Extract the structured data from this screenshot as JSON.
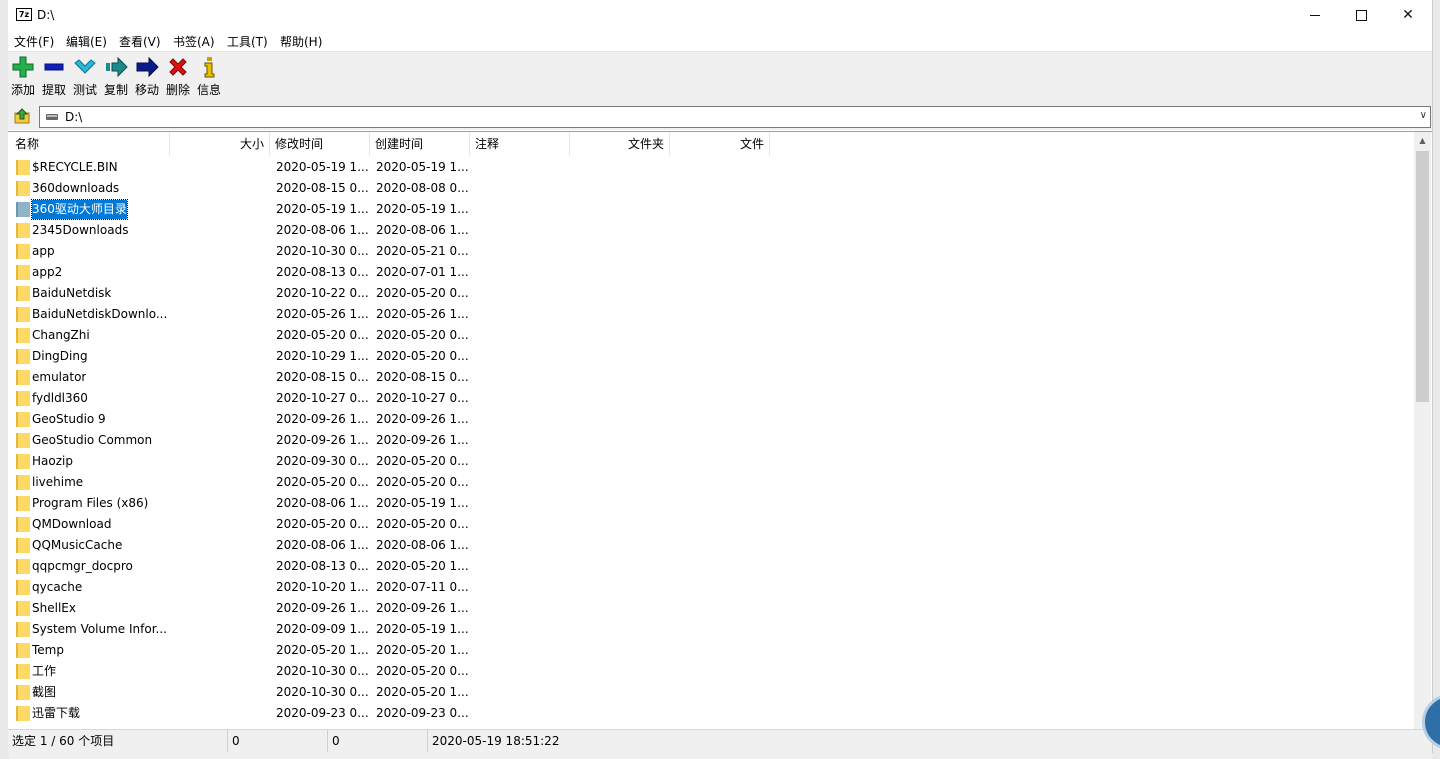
{
  "window": {
    "title": "D:\\",
    "icon": "7z-app-icon",
    "controls": [
      "minimize-icon",
      "maximize-icon",
      "close-icon"
    ]
  },
  "menu": [
    {
      "label": "文件(F)"
    },
    {
      "label": "编辑(E)"
    },
    {
      "label": "查看(V)"
    },
    {
      "label": "书签(A)"
    },
    {
      "label": "工具(T)"
    },
    {
      "label": "帮助(H)"
    }
  ],
  "toolbar": [
    {
      "label": "添加",
      "icon": "add-plus-icon",
      "color": "#22b14c"
    },
    {
      "label": "提取",
      "icon": "extract-minus-icon",
      "color": "#1020c0"
    },
    {
      "label": "测试",
      "icon": "test-check-icon",
      "color": "#2bb5d6"
    },
    {
      "label": "复制",
      "icon": "copy-arrow-icon",
      "color": "#1a8a8a"
    },
    {
      "label": "移动",
      "icon": "move-arrow-icon",
      "color": "#0a1a8a"
    },
    {
      "label": "删除",
      "icon": "delete-x-icon",
      "color": "#e01010"
    },
    {
      "label": "信息",
      "icon": "info-icon",
      "color": "#c8a000"
    }
  ],
  "address": {
    "value": "D:\\",
    "drive_icon": "drive-icon"
  },
  "columns": [
    "名称",
    "大小",
    "修改时间",
    "创建时间",
    "注释",
    "文件夹",
    "文件"
  ],
  "rows": [
    {
      "name": "$RECYCLE.BIN",
      "modified": "2020-05-19 1...",
      "created": "2020-05-19 1..."
    },
    {
      "name": "360downloads",
      "modified": "2020-08-15 0...",
      "created": "2020-08-08 0..."
    },
    {
      "name": "360驱动大师目录",
      "modified": "2020-05-19 1...",
      "created": "2020-05-19 1...",
      "selected": true
    },
    {
      "name": "2345Downloads",
      "modified": "2020-08-06 1...",
      "created": "2020-08-06 1..."
    },
    {
      "name": "app",
      "modified": "2020-10-30 0...",
      "created": "2020-05-21 0..."
    },
    {
      "name": "app2",
      "modified": "2020-08-13 0...",
      "created": "2020-07-01 1..."
    },
    {
      "name": "BaiduNetdisk",
      "modified": "2020-10-22 0...",
      "created": "2020-05-20 0..."
    },
    {
      "name": "BaiduNetdiskDownlo...",
      "modified": "2020-05-26 1...",
      "created": "2020-05-26 1..."
    },
    {
      "name": "ChangZhi",
      "modified": "2020-05-20 0...",
      "created": "2020-05-20 0..."
    },
    {
      "name": "DingDing",
      "modified": "2020-10-29 1...",
      "created": "2020-05-20 0..."
    },
    {
      "name": "emulator",
      "modified": "2020-08-15 0...",
      "created": "2020-08-15 0..."
    },
    {
      "name": "fydldl360",
      "modified": "2020-10-27 0...",
      "created": "2020-10-27 0..."
    },
    {
      "name": "GeoStudio 9",
      "modified": "2020-09-26 1...",
      "created": "2020-09-26 1..."
    },
    {
      "name": "GeoStudio Common",
      "modified": "2020-09-26 1...",
      "created": "2020-09-26 1..."
    },
    {
      "name": "Haozip",
      "modified": "2020-09-30 0...",
      "created": "2020-05-20 0..."
    },
    {
      "name": "livehime",
      "modified": "2020-05-20 0...",
      "created": "2020-05-20 0..."
    },
    {
      "name": "Program Files (x86)",
      "modified": "2020-08-06 1...",
      "created": "2020-05-19 1..."
    },
    {
      "name": "QMDownload",
      "modified": "2020-05-20 0...",
      "created": "2020-05-20 0..."
    },
    {
      "name": "QQMusicCache",
      "modified": "2020-08-06 1...",
      "created": "2020-08-06 1..."
    },
    {
      "name": "qqpcmgr_docpro",
      "modified": "2020-08-13 0...",
      "created": "2020-05-20 1..."
    },
    {
      "name": "qycache",
      "modified": "2020-10-20 1...",
      "created": "2020-07-11 0..."
    },
    {
      "name": "ShellEx",
      "modified": "2020-09-26 1...",
      "created": "2020-09-26 1..."
    },
    {
      "name": "System Volume Infor...",
      "modified": "2020-09-09 1...",
      "created": "2020-05-19 1..."
    },
    {
      "name": "Temp",
      "modified": "2020-05-20 1...",
      "created": "2020-05-20 1..."
    },
    {
      "name": "工作",
      "modified": "2020-10-30 0...",
      "created": "2020-05-20 0..."
    },
    {
      "name": "截图",
      "modified": "2020-10-30 0...",
      "created": "2020-05-20 1..."
    },
    {
      "name": "迅雷下载",
      "modified": "2020-09-23 0...",
      "created": "2020-09-23 0..."
    }
  ],
  "status": {
    "selection": "选定 1 / 60 个项目",
    "size": "0",
    "packed": "0",
    "datetime": "2020-05-19 18:51:22"
  },
  "colors": {
    "selection": "#0078d7",
    "folder": "#ffd966",
    "chrome": "#f0f0f0"
  }
}
